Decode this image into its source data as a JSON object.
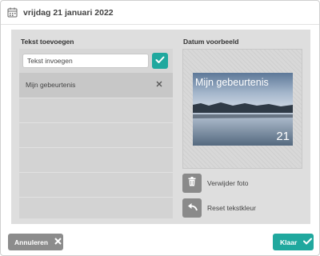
{
  "header": {
    "title": "vrijdag 21 januari 2022"
  },
  "left": {
    "section_label": "Tekst toevoegen",
    "input_placeholder": "Tekst invoegen",
    "events": [
      {
        "label": "Mijn gebeurtenis"
      }
    ]
  },
  "right": {
    "section_label": "Datum voorbeeld",
    "preview_text": "Mijn gebeurtenis",
    "preview_day": "21",
    "delete_photo_label": "Verwijder foto",
    "reset_color_label": "Reset tekstkleur"
  },
  "footer": {
    "cancel_label": "Annuleren",
    "done_label": "Klaar"
  },
  "colors": {
    "accent": "#20a89e",
    "button_grey": "#8c8c8c"
  },
  "icons": {
    "header": "calendar-icon",
    "confirm": "checkmark-icon",
    "remove_event": "close-icon",
    "delete_photo": "trash-icon",
    "reset_color": "undo-arrow-icon",
    "cancel": "close-icon",
    "done": "checkmark-icon"
  }
}
